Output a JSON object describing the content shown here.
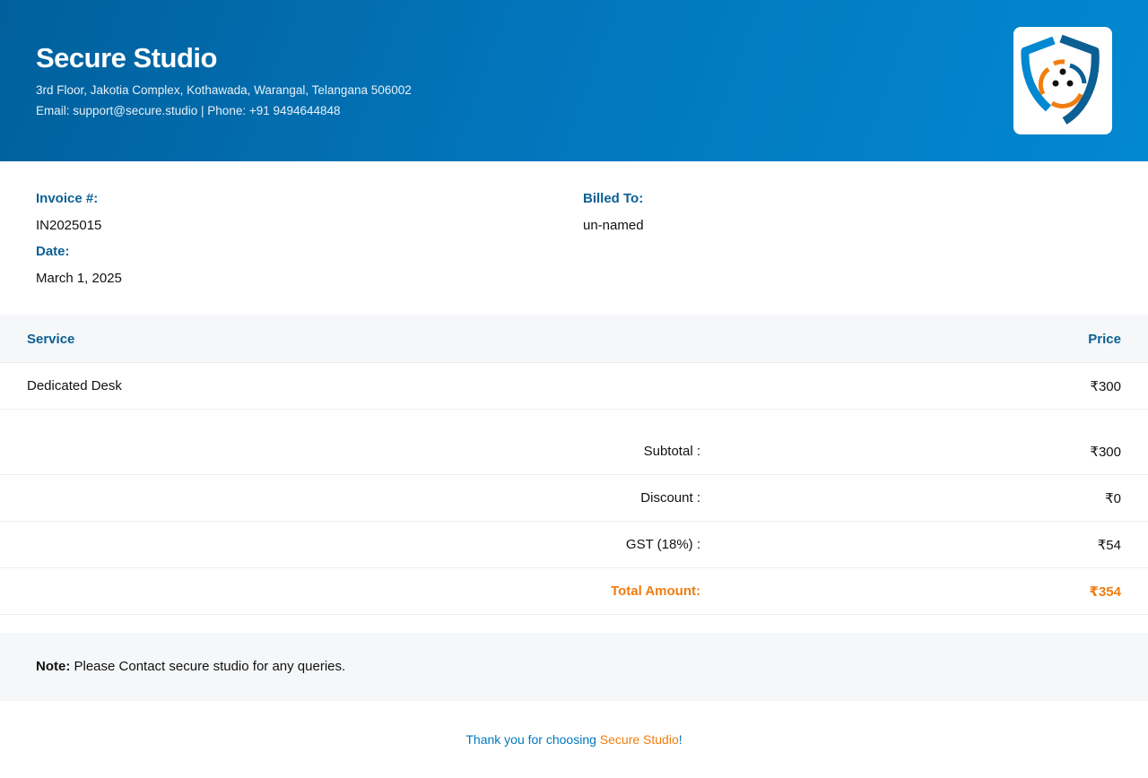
{
  "company": {
    "name": "Secure Studio",
    "address": "3rd Floor, Jakotia Complex, Kothawada, Warangal, Telangana 506002",
    "contact": "Email: support@secure.studio | Phone: +91 9494644848",
    "logo_icon": "shield-logo-icon"
  },
  "invoice": {
    "number_label": "Invoice #:",
    "number": "IN2025015",
    "date_label": "Date:",
    "date": "March 1, 2025",
    "billed_to_label": "Billed To:",
    "billed_to": "un-named"
  },
  "table": {
    "headers": {
      "service": "Service",
      "price": "Price"
    },
    "items": [
      {
        "service": "Dedicated Desk",
        "price": "₹300"
      }
    ]
  },
  "summary": {
    "subtotal_label": "Subtotal :",
    "subtotal": "₹300",
    "discount_label": "Discount :",
    "discount": "₹0",
    "gst_label": "GST (18%) :",
    "gst": "₹54",
    "total_label": "Total Amount:",
    "total": "₹354"
  },
  "note": {
    "label": "Note:",
    "text": " Please Contact secure studio for any queries."
  },
  "footer": {
    "text": "Thank you for choosing ",
    "brand": "Secure Studio",
    "suffix": "!"
  },
  "colors": {
    "primary": "#0277bd",
    "accent": "#f07d0e",
    "label": "#0b5f93"
  }
}
